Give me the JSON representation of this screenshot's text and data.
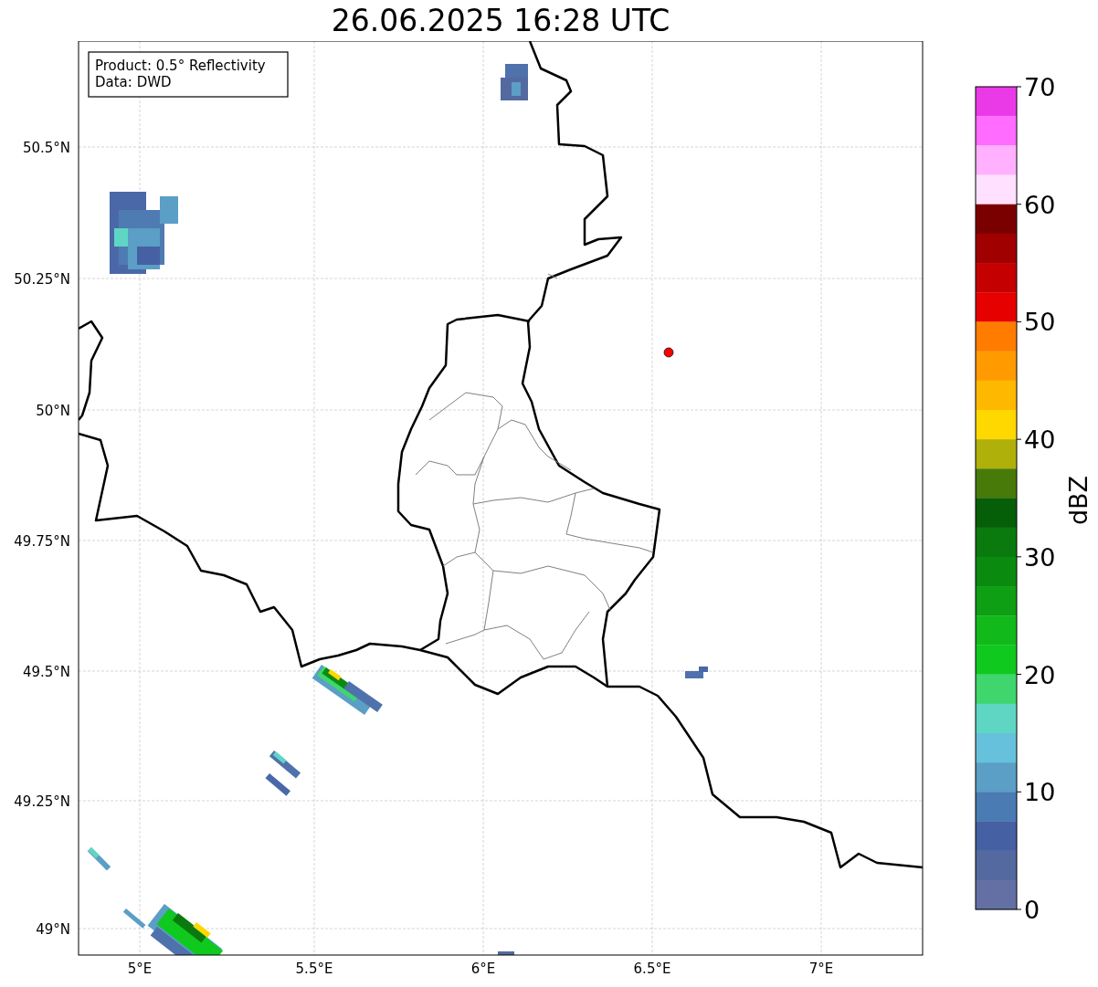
{
  "title": "26.06.2025 16:28 UTC",
  "map": {
    "info_lines": [
      "Product: 0.5° Reflectivity",
      "Data: DWD"
    ],
    "x_ticks": [
      "5°E",
      "5.5°E",
      "6°E",
      "6.5°E",
      "7°E"
    ],
    "y_ticks": [
      "50.5°N",
      "50.25°N",
      "50°N",
      "49.75°N",
      "49.5°N",
      "49.25°N",
      "49°N"
    ]
  },
  "colorbar": {
    "label": "dBZ",
    "ticks": [
      "70",
      "60",
      "50",
      "40",
      "30",
      "20",
      "10",
      "0"
    ],
    "levels": [
      {
        "color": "#ea3ae8"
      },
      {
        "color": "#ff6cff"
      },
      {
        "color": "#ffb0ff"
      },
      {
        "color": "#ffe0ff"
      },
      {
        "color": "#7a0000"
      },
      {
        "color": "#a00000"
      },
      {
        "color": "#c40000"
      },
      {
        "color": "#e60000"
      },
      {
        "color": "#ff7c00"
      },
      {
        "color": "#ff9a00"
      },
      {
        "color": "#ffb800"
      },
      {
        "color": "#ffd800"
      },
      {
        "color": "#b0b00a"
      },
      {
        "color": "#487a0a"
      },
      {
        "color": "#075e09"
      },
      {
        "color": "#0a7a0e"
      },
      {
        "color": "#0b8a10"
      },
      {
        "color": "#0f9f14"
      },
      {
        "color": "#12b91a"
      },
      {
        "color": "#10c91f"
      },
      {
        "color": "#3ed66d"
      },
      {
        "color": "#5fd6c4"
      },
      {
        "color": "#66c1dc"
      },
      {
        "color": "#5b9ec6"
      },
      {
        "color": "#4a7bb3"
      },
      {
        "color": "#4560a3"
      },
      {
        "color": "#5369a0"
      },
      {
        "color": "#6470a4"
      }
    ]
  }
}
